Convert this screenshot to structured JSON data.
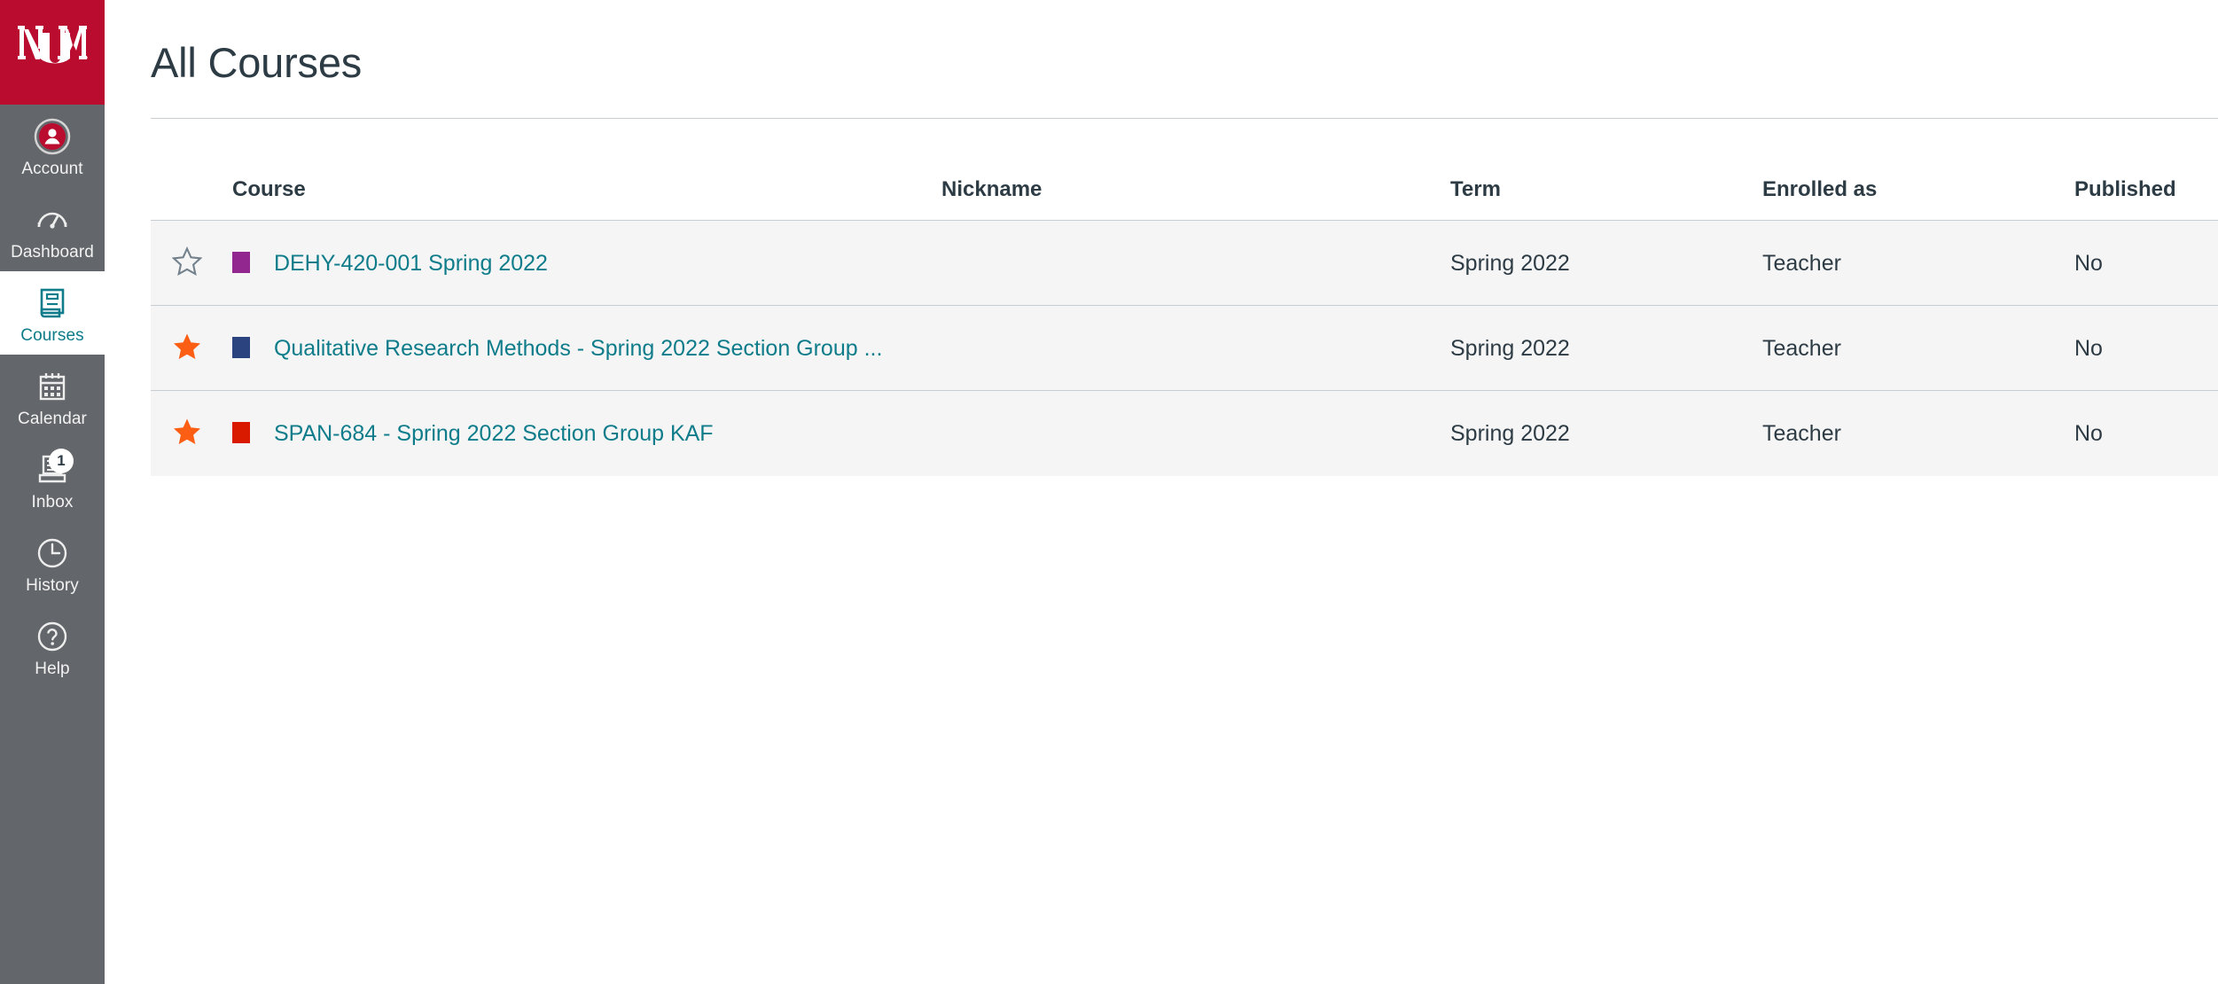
{
  "institution": {
    "logo_name": "unm-logo",
    "logo_text": "UNM",
    "brand_color": "#BA0C2F"
  },
  "global_nav": {
    "background_color": "#63666A",
    "active_text_color": "#0E7C8A",
    "items": [
      {
        "label": "Account",
        "icon": "user-avatar-icon",
        "active": false,
        "badge": ""
      },
      {
        "label": "Dashboard",
        "icon": "dashboard-icon",
        "active": false,
        "badge": ""
      },
      {
        "label": "Courses",
        "icon": "courses-book-icon",
        "active": true,
        "badge": ""
      },
      {
        "label": "Calendar",
        "icon": "calendar-icon",
        "active": false,
        "badge": ""
      },
      {
        "label": "Inbox",
        "icon": "inbox-icon",
        "active": false,
        "badge": "1"
      },
      {
        "label": "History",
        "icon": "clock-icon",
        "active": false,
        "badge": ""
      },
      {
        "label": "Help",
        "icon": "question-mark-icon",
        "active": false,
        "badge": ""
      }
    ]
  },
  "page": {
    "title": "All Courses"
  },
  "courses_table": {
    "columns": [
      "",
      "Course",
      "Nickname",
      "Term",
      "Enrolled as",
      "Published"
    ],
    "published_color": "#FC5E13",
    "link_color": "#0E7C8A",
    "rows": [
      {
        "favorite": false,
        "favorite_icon": "star-outline-icon",
        "swatch_color": "#92278F",
        "course": "DEHY-420-001 Spring 2022",
        "nickname": "",
        "term": "Spring 2022",
        "enrolled_as": "Teacher",
        "published": "No"
      },
      {
        "favorite": true,
        "favorite_icon": "star-filled-icon",
        "swatch_color": "#2B4480",
        "course": "Qualitative Research Methods - Spring 2022 Section Group ...",
        "nickname": "",
        "term": "Spring 2022",
        "enrolled_as": "Teacher",
        "published": "No"
      },
      {
        "favorite": true,
        "favorite_icon": "star-filled-icon",
        "swatch_color": "#D91A00",
        "course": "SPAN-684 - Spring 2022 Section Group KAF",
        "nickname": "",
        "term": "Spring 2022",
        "enrolled_as": "Teacher",
        "published": "No"
      }
    ]
  }
}
